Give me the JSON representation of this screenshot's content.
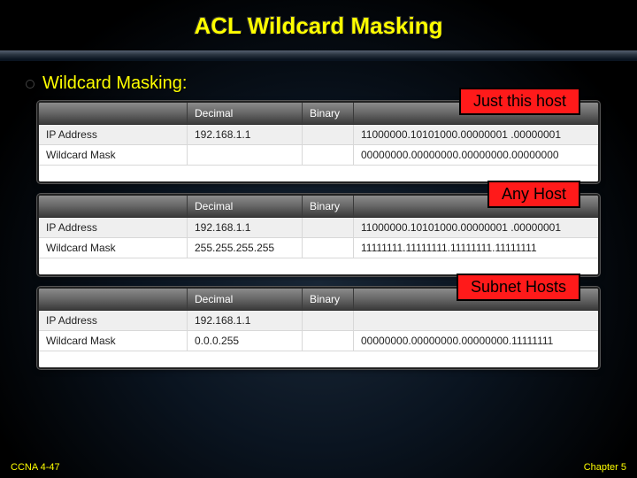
{
  "title": "ACL Wildcard Masking",
  "bullet": "Wildcard Masking:",
  "tables": [
    {
      "callout": "Just this host",
      "headers": {
        "c1": "",
        "c2": "Decimal",
        "c3": "Binary",
        "c4": ""
      },
      "rows": [
        {
          "label": "IP Address",
          "decimal": "192.168.1.1",
          "binary": "11000000.10101000.00000001 .00000001"
        },
        {
          "label": "Wildcard Mask",
          "decimal": "",
          "binary": "00000000.00000000.00000000.00000000"
        }
      ]
    },
    {
      "callout": "Any Host",
      "headers": {
        "c1": "",
        "c2": "Decimal",
        "c3": "Binary",
        "c4": ""
      },
      "rows": [
        {
          "label": "IP Address",
          "decimal": "192.168.1.1",
          "binary": "11000000.10101000.00000001 .00000001"
        },
        {
          "label": "Wildcard Mask",
          "decimal": "255.255.255.255",
          "binary": "11111111.11111111.11111111.11111111"
        }
      ]
    },
    {
      "callout": "Subnet Hosts",
      "headers": {
        "c1": "",
        "c2": "Decimal",
        "c3": "Binary",
        "c4": ""
      },
      "rows": [
        {
          "label": "IP Address",
          "decimal": "192.168.1.1",
          "binary": ""
        },
        {
          "label": "Wildcard Mask",
          "decimal": "0.0.0.255",
          "binary": "00000000.00000000.00000000.11111111"
        }
      ]
    }
  ],
  "footer": {
    "left": "CCNA 4-47",
    "right": "Chapter 5"
  }
}
